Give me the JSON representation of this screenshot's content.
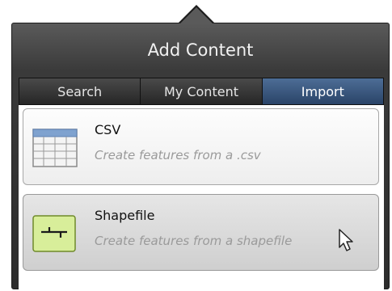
{
  "dialog": {
    "title": "Add Content",
    "tabs": [
      {
        "label": "Search",
        "active": false
      },
      {
        "label": "My Content",
        "active": false
      },
      {
        "label": "Import",
        "active": true
      }
    ]
  },
  "import_options": [
    {
      "title": "CSV",
      "description": "Create features from a .csv",
      "icon": "table-icon"
    },
    {
      "title": "Shapefile",
      "description": "Create features from a shapefile",
      "icon": "shapefile-icon"
    }
  ],
  "colors": {
    "panel": "#2c2c2c",
    "active_tab": "#3b5a82",
    "shapefile_icon_bg": "#d8ee9a"
  }
}
